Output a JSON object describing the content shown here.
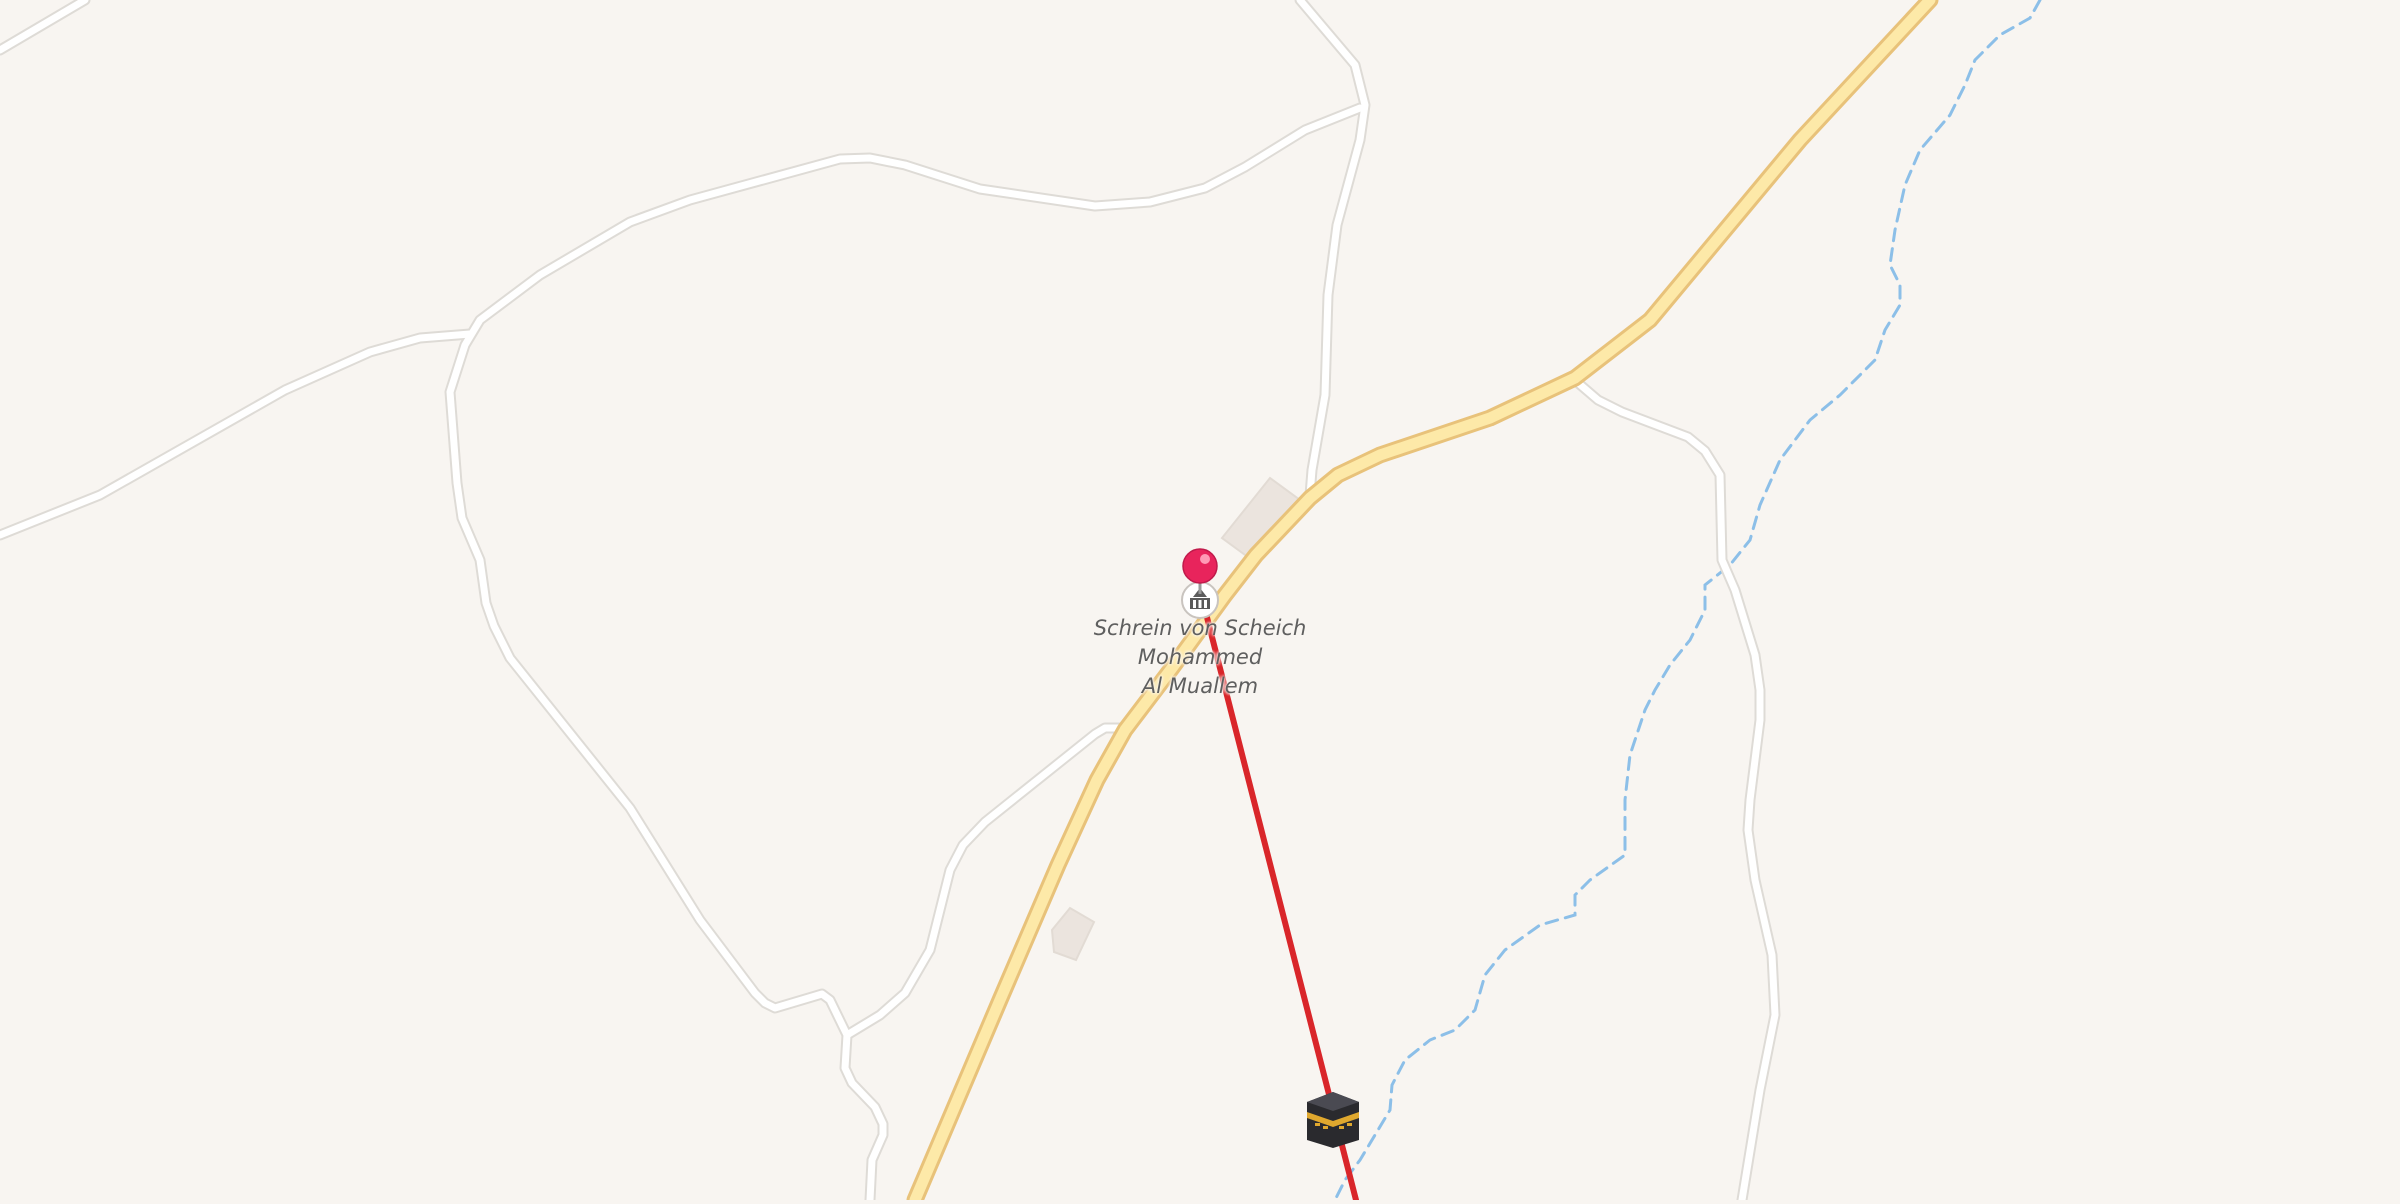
{
  "map": {
    "colors": {
      "background": "#f8f5f1",
      "minor_road_fill": "#ffffff",
      "minor_road_casing": "#dedbd6",
      "main_road_fill": "#fde9a8",
      "main_road_casing": "#e8c27a",
      "stream": "#8cbfe8",
      "building": "#ebe4de",
      "route_line": "#d9262a",
      "pin": "#e8245c"
    },
    "poi": {
      "icon": "shrine-icon",
      "label_lines": [
        "Schrein von Scheich",
        "Mohammed",
        "Al Muallem"
      ]
    },
    "pin_marker": {
      "icon": "location-pin-icon"
    },
    "route": {
      "destination_icon": "kaaba-icon"
    }
  }
}
